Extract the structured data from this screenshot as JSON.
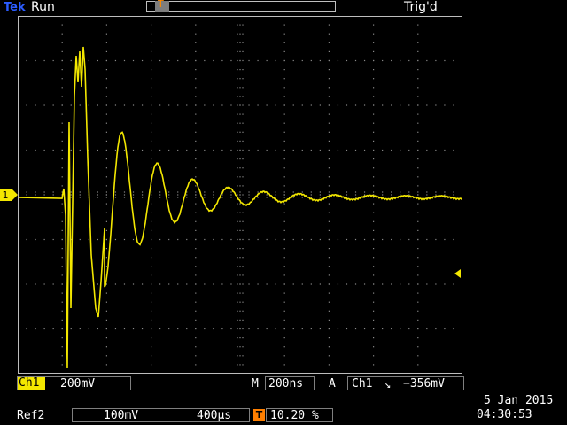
{
  "top": {
    "brand": "Tek",
    "run_state": "Run",
    "trigger_state": "Trig'd",
    "trigger_marker": "T"
  },
  "markers": {
    "channel1": "1",
    "trigger_position": "T"
  },
  "colors": {
    "trace": "#f3e700",
    "grid": "#8a8a8a",
    "trigger_marker": "#ff7f00",
    "brand": "#2b5cff"
  },
  "readouts": {
    "ch1_label": "Ch1",
    "ch1_scale": "200mV",
    "time_prefix": "M",
    "time_scale": "200ns",
    "trigger_mode": "A",
    "trigger_source": "Ch1",
    "trigger_slope": "↘",
    "trigger_level": "−356mV",
    "ref2_label": "Ref2",
    "ref2_scale": "100mV",
    "ref2_time": "400µs",
    "horizontal_position_icon": "T",
    "horizontal_position": "10.20 %",
    "date": "5 Jan  2015",
    "time": "04:30:53"
  }
}
